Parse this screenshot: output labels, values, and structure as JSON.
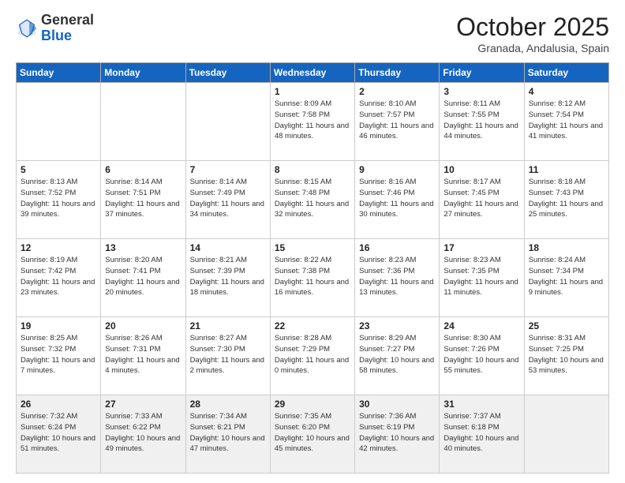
{
  "header": {
    "logo_general": "General",
    "logo_blue": "Blue",
    "month_title": "October 2025",
    "location": "Granada, Andalusia, Spain"
  },
  "weekdays": [
    "Sunday",
    "Monday",
    "Tuesday",
    "Wednesday",
    "Thursday",
    "Friday",
    "Saturday"
  ],
  "weeks": [
    [
      {
        "day": "",
        "info": ""
      },
      {
        "day": "",
        "info": ""
      },
      {
        "day": "",
        "info": ""
      },
      {
        "day": "1",
        "info": "Sunrise: 8:09 AM\nSunset: 7:58 PM\nDaylight: 11 hours\nand 48 minutes."
      },
      {
        "day": "2",
        "info": "Sunrise: 8:10 AM\nSunset: 7:57 PM\nDaylight: 11 hours\nand 46 minutes."
      },
      {
        "day": "3",
        "info": "Sunrise: 8:11 AM\nSunset: 7:55 PM\nDaylight: 11 hours\nand 44 minutes."
      },
      {
        "day": "4",
        "info": "Sunrise: 8:12 AM\nSunset: 7:54 PM\nDaylight: 11 hours\nand 41 minutes."
      }
    ],
    [
      {
        "day": "5",
        "info": "Sunrise: 8:13 AM\nSunset: 7:52 PM\nDaylight: 11 hours\nand 39 minutes."
      },
      {
        "day": "6",
        "info": "Sunrise: 8:14 AM\nSunset: 7:51 PM\nDaylight: 11 hours\nand 37 minutes."
      },
      {
        "day": "7",
        "info": "Sunrise: 8:14 AM\nSunset: 7:49 PM\nDaylight: 11 hours\nand 34 minutes."
      },
      {
        "day": "8",
        "info": "Sunrise: 8:15 AM\nSunset: 7:48 PM\nDaylight: 11 hours\nand 32 minutes."
      },
      {
        "day": "9",
        "info": "Sunrise: 8:16 AM\nSunset: 7:46 PM\nDaylight: 11 hours\nand 30 minutes."
      },
      {
        "day": "10",
        "info": "Sunrise: 8:17 AM\nSunset: 7:45 PM\nDaylight: 11 hours\nand 27 minutes."
      },
      {
        "day": "11",
        "info": "Sunrise: 8:18 AM\nSunset: 7:43 PM\nDaylight: 11 hours\nand 25 minutes."
      }
    ],
    [
      {
        "day": "12",
        "info": "Sunrise: 8:19 AM\nSunset: 7:42 PM\nDaylight: 11 hours\nand 23 minutes."
      },
      {
        "day": "13",
        "info": "Sunrise: 8:20 AM\nSunset: 7:41 PM\nDaylight: 11 hours\nand 20 minutes."
      },
      {
        "day": "14",
        "info": "Sunrise: 8:21 AM\nSunset: 7:39 PM\nDaylight: 11 hours\nand 18 minutes."
      },
      {
        "day": "15",
        "info": "Sunrise: 8:22 AM\nSunset: 7:38 PM\nDaylight: 11 hours\nand 16 minutes."
      },
      {
        "day": "16",
        "info": "Sunrise: 8:23 AM\nSunset: 7:36 PM\nDaylight: 11 hours\nand 13 minutes."
      },
      {
        "day": "17",
        "info": "Sunrise: 8:23 AM\nSunset: 7:35 PM\nDaylight: 11 hours\nand 11 minutes."
      },
      {
        "day": "18",
        "info": "Sunrise: 8:24 AM\nSunset: 7:34 PM\nDaylight: 11 hours\nand 9 minutes."
      }
    ],
    [
      {
        "day": "19",
        "info": "Sunrise: 8:25 AM\nSunset: 7:32 PM\nDaylight: 11 hours\nand 7 minutes."
      },
      {
        "day": "20",
        "info": "Sunrise: 8:26 AM\nSunset: 7:31 PM\nDaylight: 11 hours\nand 4 minutes."
      },
      {
        "day": "21",
        "info": "Sunrise: 8:27 AM\nSunset: 7:30 PM\nDaylight: 11 hours\nand 2 minutes."
      },
      {
        "day": "22",
        "info": "Sunrise: 8:28 AM\nSunset: 7:29 PM\nDaylight: 11 hours\nand 0 minutes."
      },
      {
        "day": "23",
        "info": "Sunrise: 8:29 AM\nSunset: 7:27 PM\nDaylight: 10 hours\nand 58 minutes."
      },
      {
        "day": "24",
        "info": "Sunrise: 8:30 AM\nSunset: 7:26 PM\nDaylight: 10 hours\nand 55 minutes."
      },
      {
        "day": "25",
        "info": "Sunrise: 8:31 AM\nSunset: 7:25 PM\nDaylight: 10 hours\nand 53 minutes."
      }
    ],
    [
      {
        "day": "26",
        "info": "Sunrise: 7:32 AM\nSunset: 6:24 PM\nDaylight: 10 hours\nand 51 minutes."
      },
      {
        "day": "27",
        "info": "Sunrise: 7:33 AM\nSunset: 6:22 PM\nDaylight: 10 hours\nand 49 minutes."
      },
      {
        "day": "28",
        "info": "Sunrise: 7:34 AM\nSunset: 6:21 PM\nDaylight: 10 hours\nand 47 minutes."
      },
      {
        "day": "29",
        "info": "Sunrise: 7:35 AM\nSunset: 6:20 PM\nDaylight: 10 hours\nand 45 minutes."
      },
      {
        "day": "30",
        "info": "Sunrise: 7:36 AM\nSunset: 6:19 PM\nDaylight: 10 hours\nand 42 minutes."
      },
      {
        "day": "31",
        "info": "Sunrise: 7:37 AM\nSunset: 6:18 PM\nDaylight: 10 hours\nand 40 minutes."
      },
      {
        "day": "",
        "info": ""
      }
    ]
  ]
}
